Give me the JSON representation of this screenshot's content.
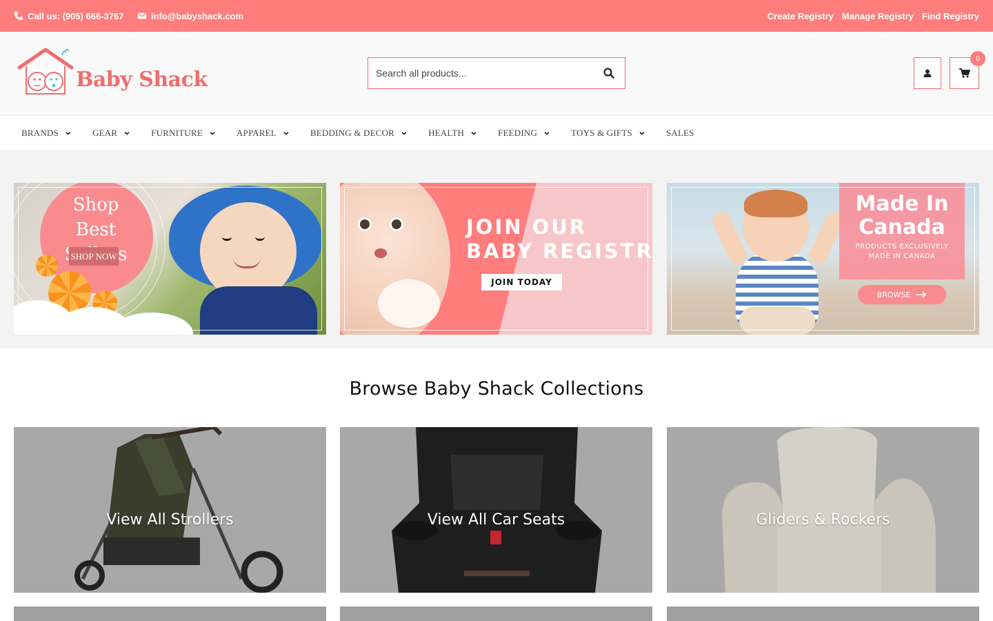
{
  "topbar": {
    "phone_label": "Call us: (905) 666-3767",
    "email_label": "info@babyshack.com",
    "links": [
      "Create Registry",
      "Manage Registry",
      "Find Registry"
    ],
    "background": "#ff7d7d"
  },
  "header": {
    "logo_text": "Baby Shack",
    "search_placeholder": "Search all products...",
    "cart_count": "0",
    "accent": "#ea6b6b"
  },
  "nav": {
    "items": [
      "BRANDS",
      "GEAR",
      "FURNITURE",
      "APPAREL",
      "BEDDING & DECOR",
      "HEALTH",
      "FEEDING",
      "TOYS & GIFTS",
      "SALES"
    ]
  },
  "banners": {
    "best_sellers": {
      "title": "Shop Best Sellers",
      "cta": "SHOP NOW"
    },
    "registry": {
      "title_line1": "JOIN OUR",
      "title_line2": "BABY REGISTRY",
      "cta": "JOIN TODAY"
    },
    "canada": {
      "title_line1": "Made In",
      "title_line2": "Canada",
      "subtitle": "PRODUCTS EXCLUSIVELY MADE IN CANADA",
      "cta": "BROWSE"
    }
  },
  "collections": {
    "heading": "Browse Baby Shack Collections",
    "cards": [
      "View All Strollers",
      "View All Car Seats",
      "Gliders & Rockers"
    ]
  }
}
